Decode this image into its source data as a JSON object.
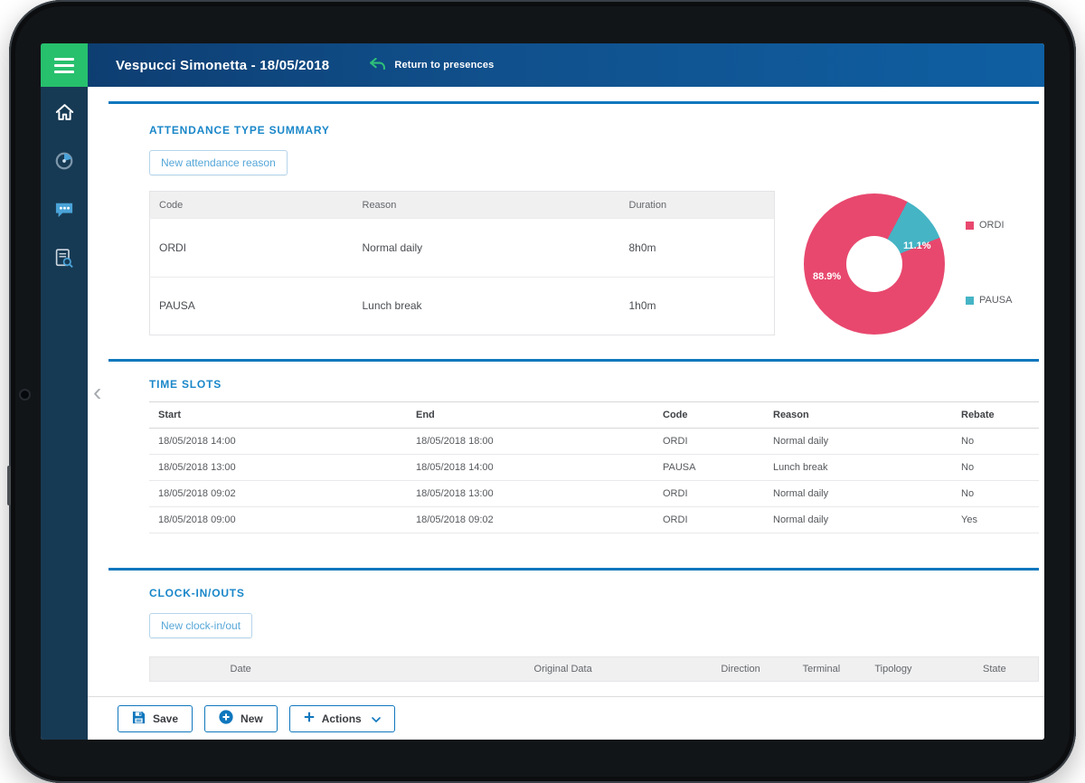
{
  "header": {
    "title": "Vespucci Simonetta - 18/05/2018",
    "return_link": "Return to presences"
  },
  "icons": {
    "collapse_chevron": "‹"
  },
  "sidebar": {
    "items": [
      {
        "icon": "home-icon"
      },
      {
        "icon": "presences-icon"
      },
      {
        "icon": "messages-icon"
      },
      {
        "icon": "reports-icon"
      }
    ]
  },
  "attendance_summary": {
    "title": "ATTENDANCE TYPE SUMMARY",
    "new_button_label": "New attendance reason",
    "columns": [
      "Code",
      "Reason",
      "Duration"
    ],
    "rows": [
      [
        "ORDI",
        "Normal daily",
        "8h0m"
      ],
      [
        "PAUSA",
        "Lunch break",
        "1h0m"
      ]
    ]
  },
  "chart_data": {
    "type": "pie",
    "donut": true,
    "categories": [
      "ORDI",
      "PAUSA"
    ],
    "values": [
      88.9,
      11.1
    ],
    "labels": [
      "88.9%",
      "11.1%"
    ],
    "legend": [
      "ORDI",
      "PAUSA"
    ],
    "colors": [
      "#e8486e",
      "#45b4c5"
    ],
    "legend_position": "right",
    "start_angle_deg": 28
  },
  "time_slots": {
    "title": "TIME SLOTS",
    "columns": [
      "Start",
      "End",
      "Code",
      "Reason",
      "Rebate"
    ],
    "rows": [
      [
        "18/05/2018 14:00",
        "18/05/2018 18:00",
        "ORDI",
        "Normal daily",
        "No"
      ],
      [
        "18/05/2018 13:00",
        "18/05/2018 14:00",
        "PAUSA",
        "Lunch break",
        "No"
      ],
      [
        "18/05/2018 09:02",
        "18/05/2018 13:00",
        "ORDI",
        "Normal daily",
        "No"
      ],
      [
        "18/05/2018 09:00",
        "18/05/2018 09:02",
        "ORDI",
        "Normal daily",
        "Yes"
      ]
    ]
  },
  "clock_in_outs": {
    "title": "CLOCK-IN/OUTS",
    "new_button_label": "New clock-in/out",
    "columns": [
      "Date",
      "Original Data",
      "Direction",
      "Terminal",
      "Tipology",
      "State"
    ]
  },
  "toolbar": {
    "save_label": "Save",
    "new_label": "New",
    "actions_label": "Actions"
  },
  "colors": {
    "accent_blue": "#1077bd",
    "section_title_blue": "#1a87c9",
    "header_green": "#27c06d",
    "pie_ordi": "#e8486e",
    "pie_pausa": "#45b4c5"
  }
}
